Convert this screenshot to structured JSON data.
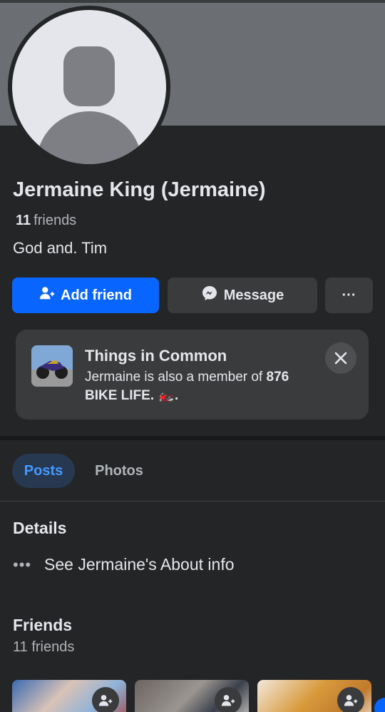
{
  "profile": {
    "name": "Jermaine King (Jermaine)",
    "friends_count": "11",
    "friends_word": "friends",
    "bio": "God and. Tim"
  },
  "actions": {
    "add_friend": "Add friend",
    "message": "Message",
    "more": "···"
  },
  "things_in_common": {
    "title": "Things in Common",
    "desc_prefix": "Jermaine is also a member of ",
    "group_name": "876 BIKE LIFE. 🏍️.",
    "close": "✕"
  },
  "tabs": {
    "posts": "Posts",
    "photos": "Photos"
  },
  "details": {
    "title": "Details",
    "about_dots": "•••",
    "about_link": "See Jermaine's About info"
  },
  "friends_section": {
    "title": "Friends",
    "count_label": "11 friends"
  },
  "colors": {
    "accent": "#0866ff",
    "background": "#242526",
    "tab_active_bg": "#263951",
    "tab_active_text": "#4599ff"
  }
}
